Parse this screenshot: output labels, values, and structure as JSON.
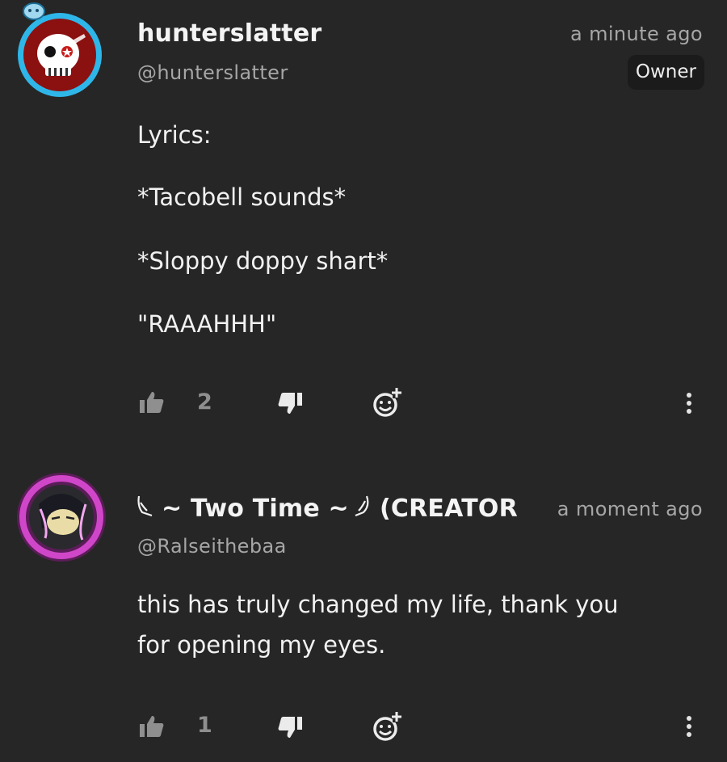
{
  "comments": [
    {
      "username": "hunterslatter",
      "handle": "@hunterslatter",
      "time": "a minute ago",
      "badge": "Owner",
      "body_lines": [
        "Lyrics:",
        "*Tacobell sounds*",
        "*Sloppy doppy shart*",
        "\"RAAAHHH\""
      ],
      "like_count": "2",
      "icons": [
        "thumbs-up-icon",
        "thumbs-down-icon",
        "add-reaction-icon",
        "more-options-icon"
      ]
    },
    {
      "username": "~ Two Time ~",
      "username_suffix": "(CREATOR",
      "handle": "@Ralseithebaa",
      "time": "a moment ago",
      "body_lines": [
        "this has truly changed my life, thank you",
        "for opening my eyes."
      ],
      "like_count": "1",
      "icons": [
        "thumbs-up-icon",
        "thumbs-down-icon",
        "add-reaction-icon",
        "more-options-icon"
      ]
    }
  ],
  "colors": {
    "background": "#262626",
    "text_primary": "#f2f2f2",
    "text_secondary": "#a6a6a6",
    "icon_muted": "#8f8f8f",
    "badge_bg": "#1b1b1b",
    "avatar1_ring": "#2fb6e8",
    "avatar1_fill": "#8b1010",
    "avatar2_ring": "#b93bb0"
  }
}
